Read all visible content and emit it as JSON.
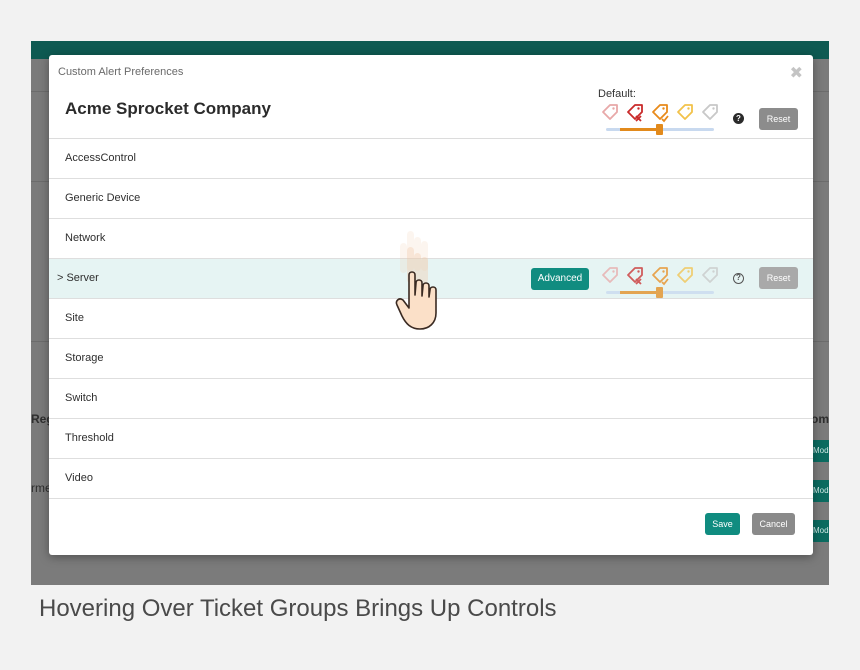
{
  "background": {
    "left_label": "Reg",
    "left_label_2": "rme",
    "right_label": "om",
    "right_buttons": [
      "Mod",
      "Mod",
      "Mod"
    ]
  },
  "modal": {
    "title": "Custom Alert Preferences",
    "close_symbol": "✖",
    "company": "Acme Sprocket Company",
    "default_label": "Default:",
    "reset_label": "Reset",
    "help_symbol": "?",
    "rows": [
      {
        "label": "AccessControl"
      },
      {
        "label": "Generic Device"
      },
      {
        "label": "Network"
      },
      {
        "label": "Server",
        "hover": true,
        "chevron": ">",
        "advanced_label": "Advanced",
        "reset_label": "Reset"
      },
      {
        "label": "Site"
      },
      {
        "label": "Storage"
      },
      {
        "label": "Switch"
      },
      {
        "label": "Threshold"
      },
      {
        "label": "Video"
      }
    ],
    "save_label": "Save",
    "cancel_label": "Cancel",
    "severity_colors": [
      "#e8a8a8",
      "#c92a2a",
      "#e88a1a",
      "#f2c24a",
      "#c8c8c8"
    ],
    "accent_color": "#108c80",
    "slider_value": {
      "min": 1,
      "max": 2
    }
  },
  "caption": "Hovering Over Ticket Groups Brings Up Controls"
}
